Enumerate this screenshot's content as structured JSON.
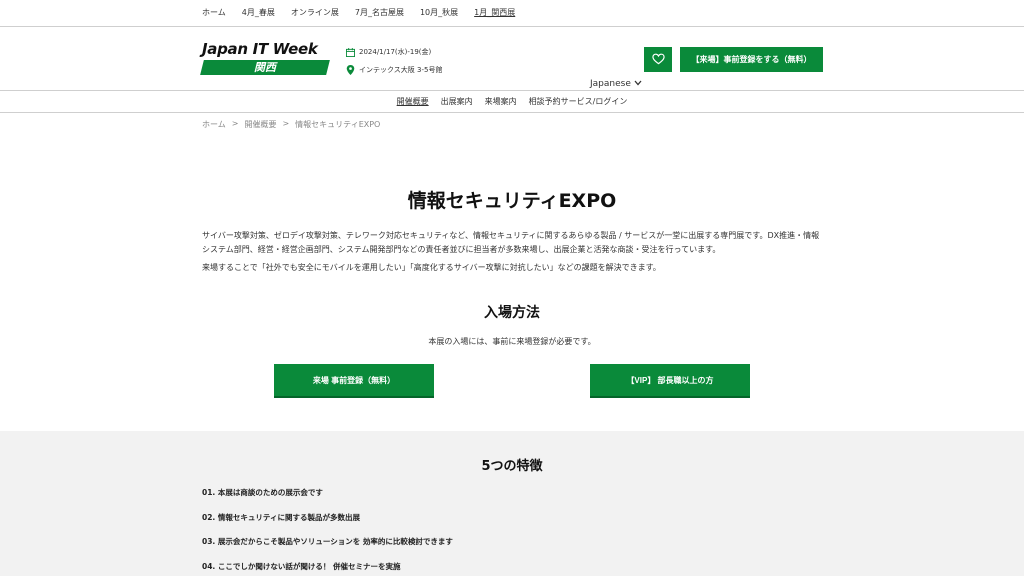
{
  "topnav": {
    "items": [
      "ホーム",
      "4月_春展",
      "オンライン展",
      "7月_名古屋展",
      "10月_秋展",
      "1月_関西展"
    ]
  },
  "header": {
    "logo_title": "Japan IT Week",
    "logo_sub": "関西",
    "date": "2024/1/17(水)-19(金)",
    "venue": "インテックス大阪 3-5号館",
    "language": "Japanese",
    "register_label": "【来場】事前登録をする（無料）"
  },
  "subnav": {
    "items": [
      "開催概要",
      "出展案内",
      "来場案内",
      "相談予約サービス/ログイン"
    ]
  },
  "breadcrumb": {
    "items": [
      "ホーム",
      ">",
      "開催概要",
      ">",
      "情報セキュリティEXPO"
    ]
  },
  "main": {
    "title": "情報セキュリティEXPO",
    "description": "サイバー攻撃対策、ゼロデイ攻撃対策、テレワーク対応セキュリティなど、情報セキュリティに関するあらゆる製品 / サービスが一堂に出展する専門展です。DX推進・情報システム部門、経営・経営企画部門、システム開発部門などの責任者並びに担当者が多数来場し、出展企業と活発な商談・受注を行っています。",
    "description2": "来場することで「社外でも安全にモバイルを運用したい」「高度化するサイバー攻撃に対抗したい」などの課題を解決できます。"
  },
  "admission": {
    "title": "入場方法",
    "desc": "本展の入場には、事前に来場登録が必要です。",
    "btn1": "来場 事前登録（無料）",
    "btn2": "【VIP】 部長職以上の方"
  },
  "features": {
    "title": "5つの特徴",
    "items": [
      "01. 本展は商談のための展示会です",
      "02. 情報セキュリティに関する製品が多数出展",
      "03. 展示会だからこそ製品やソリューションを 効率的に比較検討できます",
      "04. ここでしか聞けない話が聞ける！ 併催セミナーを実施"
    ]
  },
  "colors": {
    "brand_green": "#0a8a3a"
  }
}
